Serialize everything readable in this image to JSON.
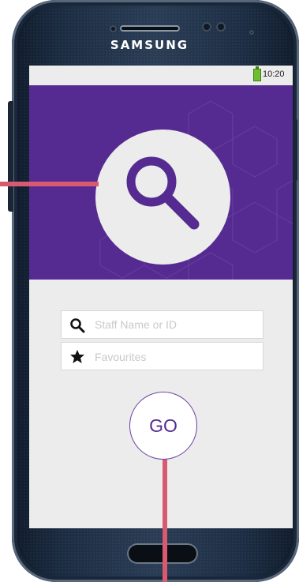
{
  "device": {
    "brand": "SAMSUNG"
  },
  "status_bar": {
    "time": "10:20",
    "battery_icon": "battery-icon"
  },
  "hero": {
    "icon": "search-icon",
    "background_color": "#562b91",
    "circle_color": "#ececec"
  },
  "search": {
    "placeholder": "Staff Name or ID",
    "value": "",
    "icon": "search-icon"
  },
  "favourites": {
    "label": "Favourites",
    "icon": "star-icon"
  },
  "go_button": {
    "label": "GO"
  },
  "colors": {
    "accent": "#562b91",
    "annotation": "#d75a71",
    "screen_bg": "#ececec"
  }
}
